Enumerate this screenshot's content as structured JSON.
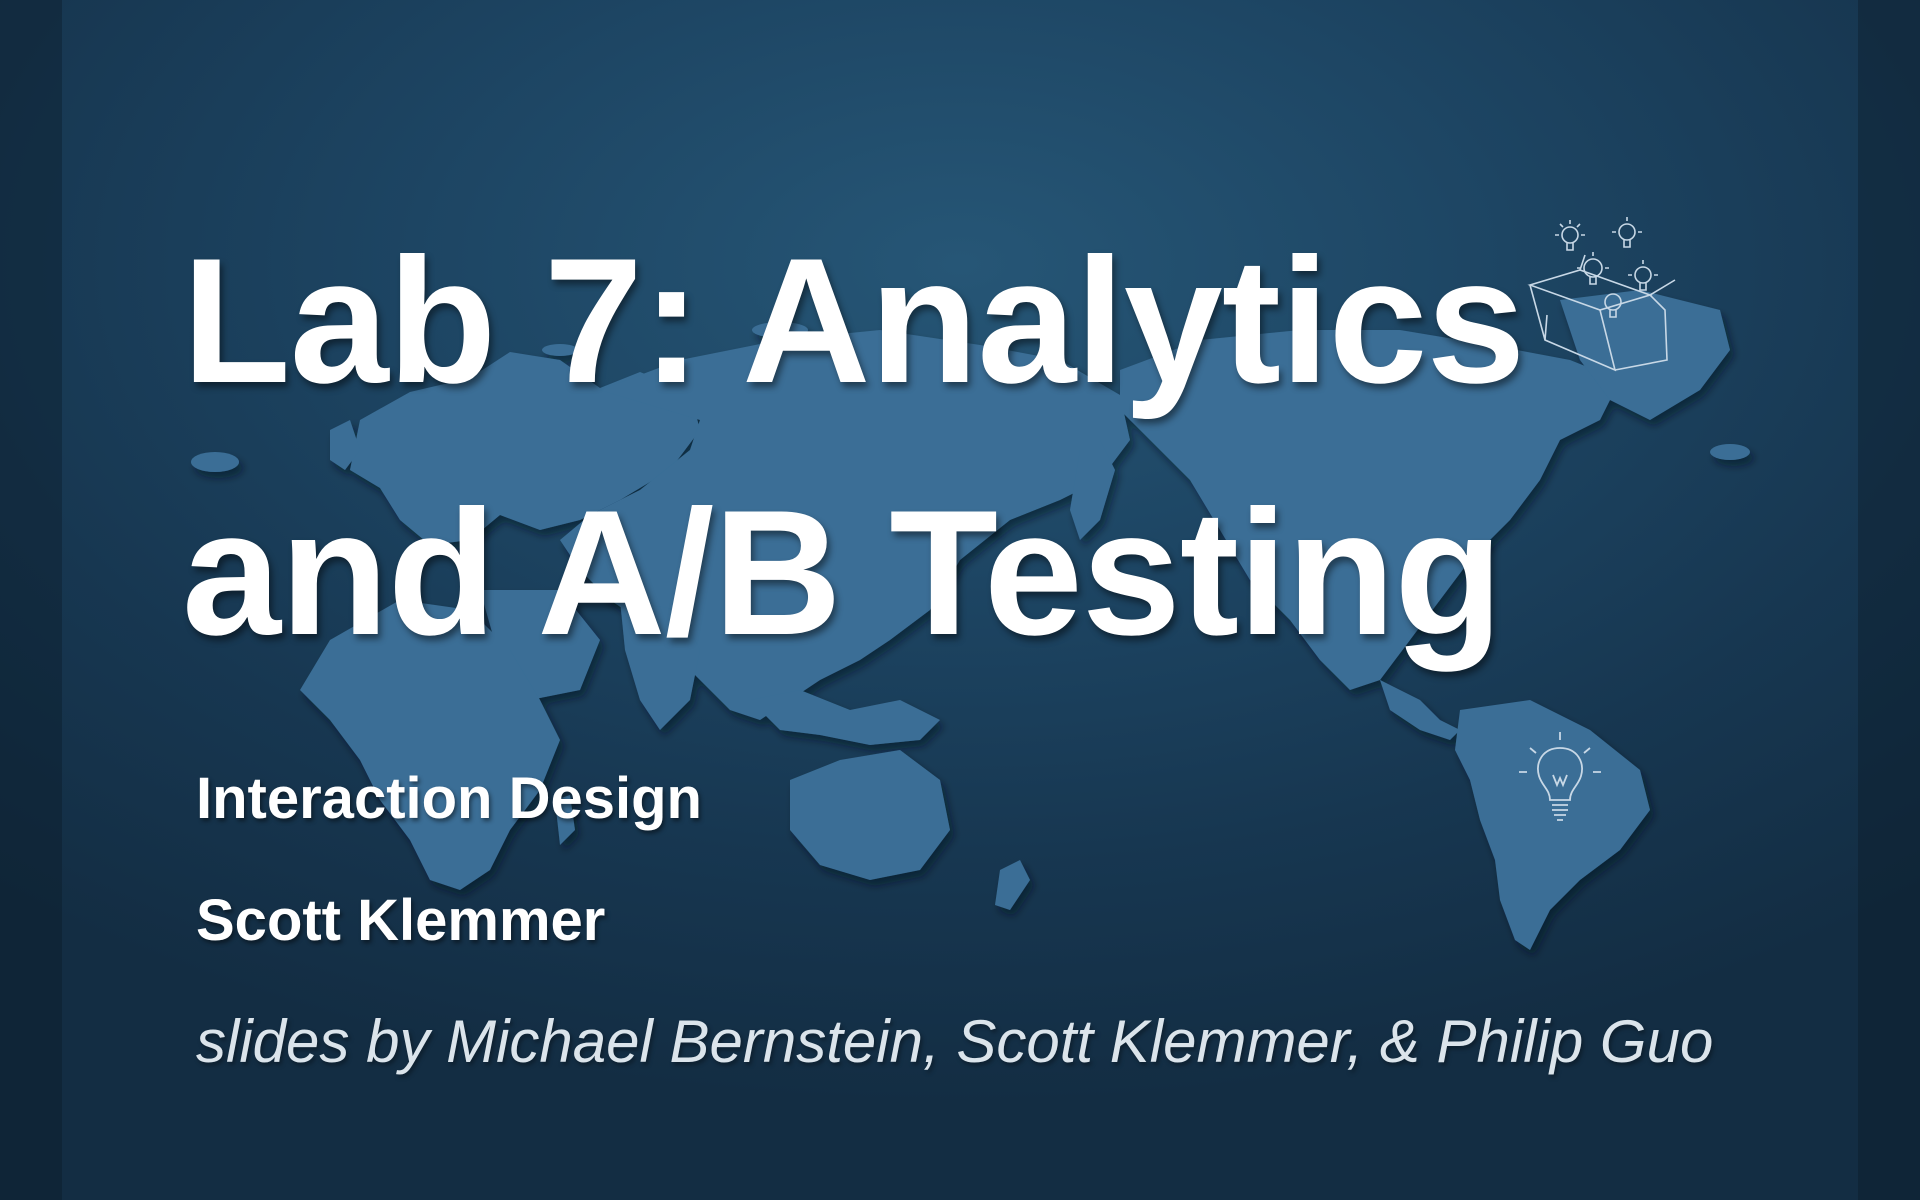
{
  "slide": {
    "title_line_1": "Lab 7: Analytics",
    "title_line_2": "and A/B Testing",
    "course": "Interaction Design",
    "author": "Scott Klemmer",
    "credits": "slides by Michael Bernstein, Scott Klemmer, & Philip Guo"
  },
  "colors": {
    "background": "#1d4563",
    "map_fill": "#3a6e96",
    "text": "#ffffff"
  },
  "icons": {
    "background": "world-map",
    "decoration_top": "lightbulbs-out-of-box-icon",
    "decoration_south_america": "lightbulb-icon"
  }
}
